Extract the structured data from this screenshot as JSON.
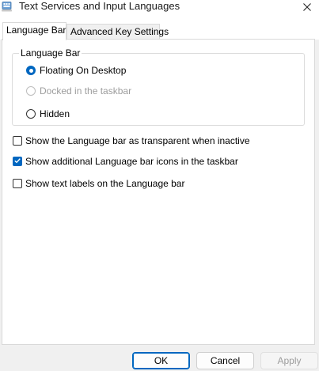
{
  "window": {
    "title": "Text Services and Input Languages",
    "app_icon": "keyboard-icon",
    "close_icon": "close-icon"
  },
  "tabs": [
    {
      "label": "Language Bar",
      "active": true
    },
    {
      "label": "Advanced Key Settings",
      "active": false
    }
  ],
  "language_bar_group": {
    "title": "Language Bar",
    "options": [
      {
        "label": "Floating On Desktop",
        "selected": true,
        "enabled": true
      },
      {
        "label": "Docked in the taskbar",
        "selected": false,
        "enabled": false
      },
      {
        "label": "Hidden",
        "selected": false,
        "enabled": true
      }
    ]
  },
  "checkboxes": [
    {
      "label": "Show the Language bar as transparent when inactive",
      "checked": false
    },
    {
      "label": "Show additional Language bar icons in the taskbar",
      "checked": true
    },
    {
      "label": "Show text labels on the Language bar",
      "checked": false
    }
  ],
  "footer": {
    "ok_label": "OK",
    "cancel_label": "Cancel",
    "apply_label": "Apply"
  },
  "colors": {
    "accent": "#0067c0",
    "disabled_text": "#9d9d9d"
  }
}
